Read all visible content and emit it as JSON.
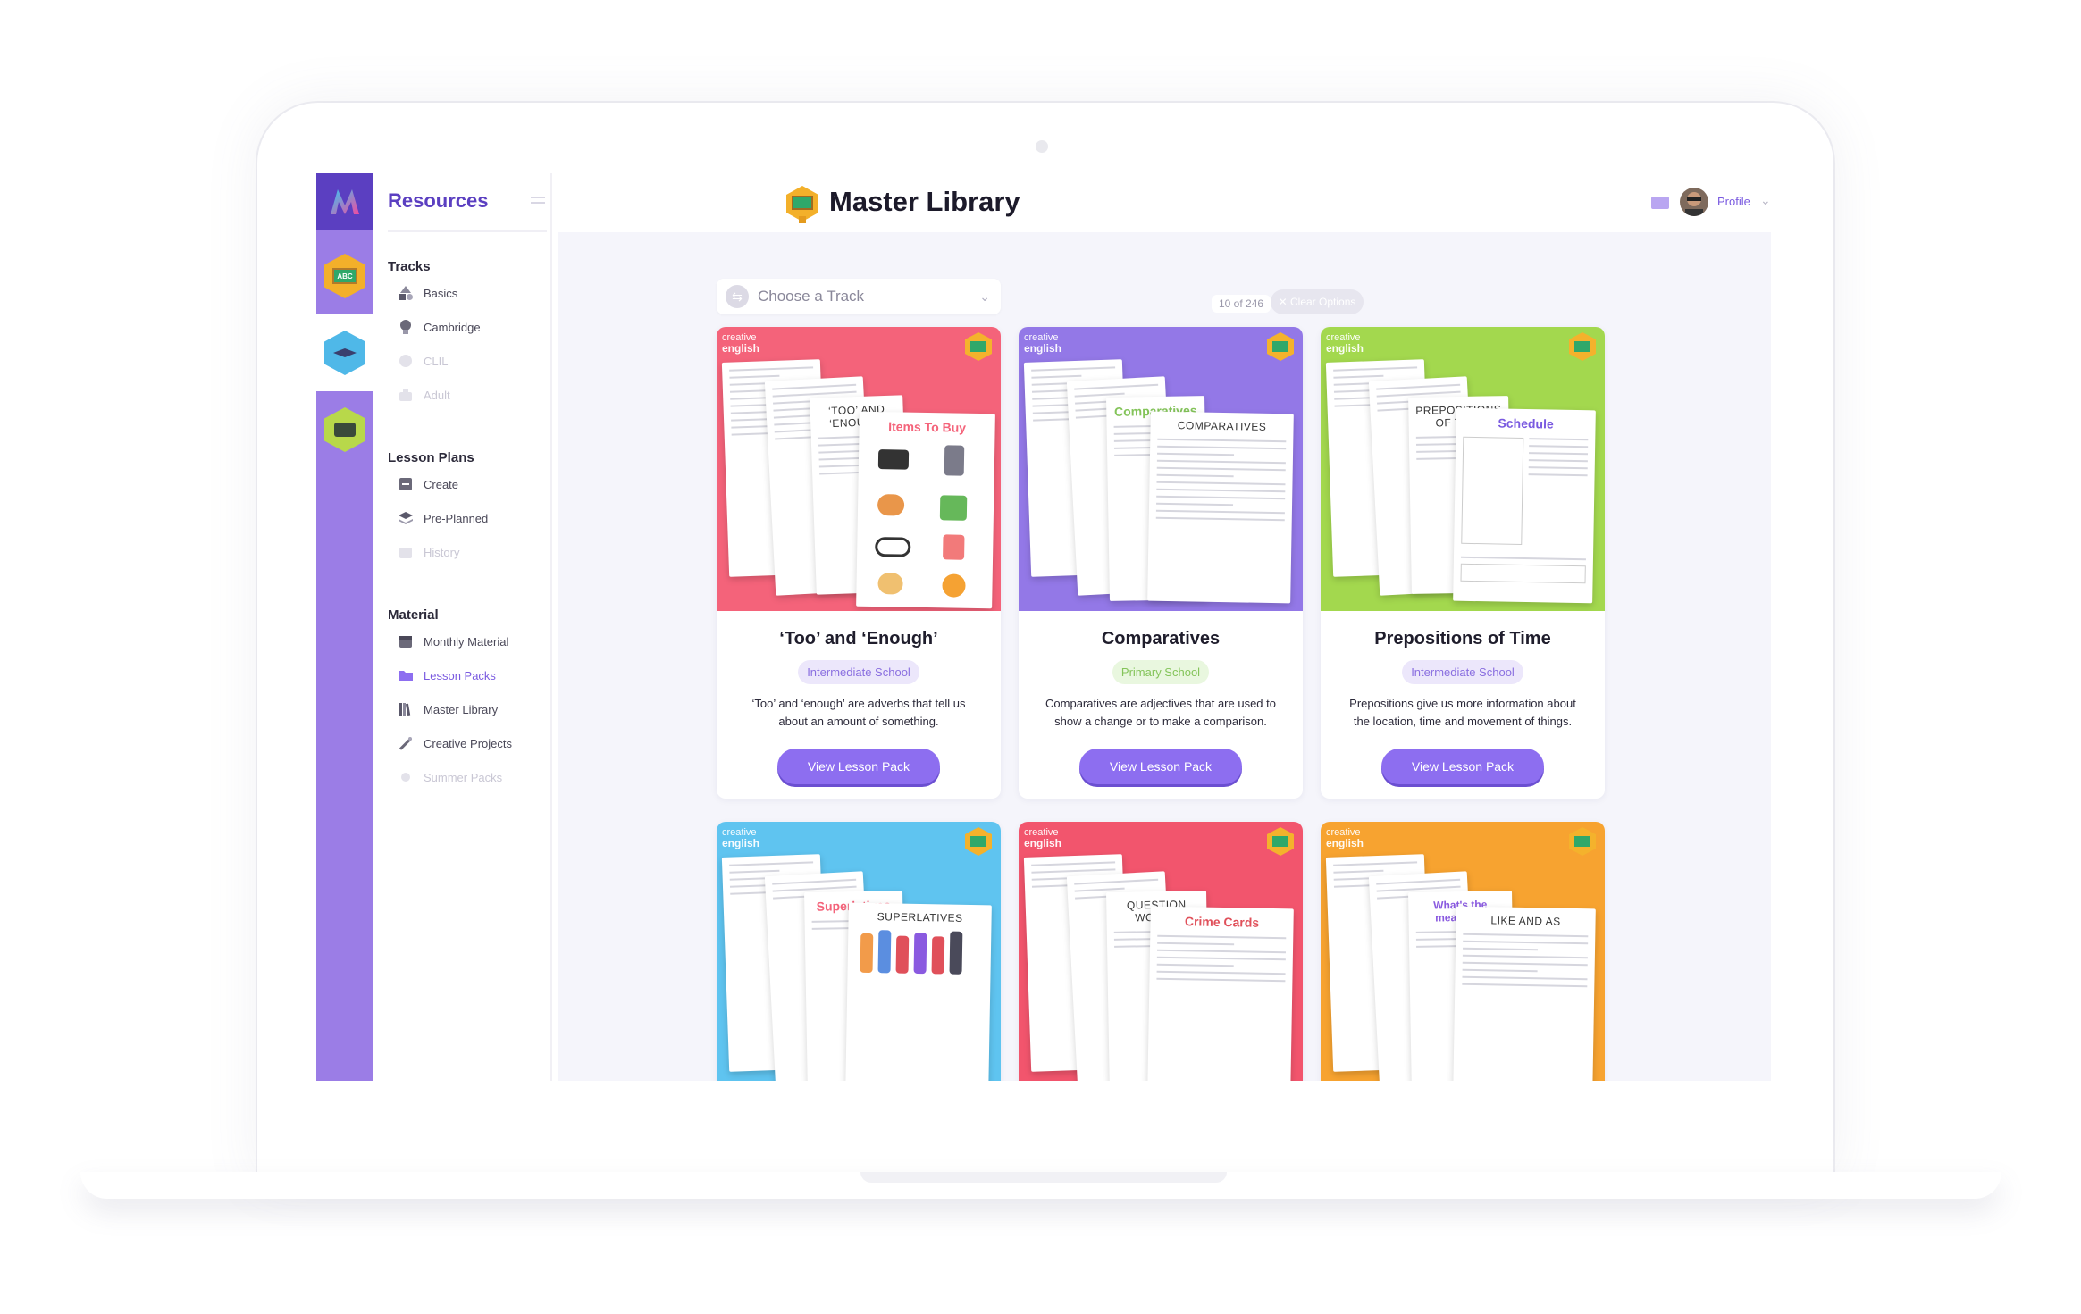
{
  "sidebar": {
    "title": "Resources",
    "sections": [
      {
        "label": "Tracks",
        "items": [
          {
            "label": "Basics",
            "state": "normal",
            "icon": "shapes-icon"
          },
          {
            "label": "Cambridge",
            "state": "normal",
            "icon": "cambridge-icon"
          },
          {
            "label": "CLIL",
            "state": "disabled",
            "icon": "globe-icon"
          },
          {
            "label": "Adult",
            "state": "disabled",
            "icon": "briefcase-icon"
          }
        ]
      },
      {
        "label": "Lesson Plans",
        "items": [
          {
            "label": "Create",
            "state": "normal",
            "icon": "create-icon"
          },
          {
            "label": "Pre-Planned",
            "state": "normal",
            "icon": "layers-icon"
          },
          {
            "label": "History",
            "state": "disabled",
            "icon": "history-icon"
          }
        ]
      },
      {
        "label": "Material",
        "items": [
          {
            "label": "Monthly Material",
            "state": "normal",
            "icon": "calendar-icon"
          },
          {
            "label": "Lesson Packs",
            "state": "active",
            "icon": "folder-icon"
          },
          {
            "label": "Master Library",
            "state": "normal",
            "icon": "books-icon"
          },
          {
            "label": "Creative Projects",
            "state": "normal",
            "icon": "wand-icon"
          },
          {
            "label": "Summer Packs",
            "state": "disabled",
            "icon": "sun-icon"
          }
        ]
      }
    ]
  },
  "header": {
    "title": "Master Library",
    "profile_label": "Profile"
  },
  "filters": {
    "track_placeholder": "Choose a Track",
    "count": "10 of 246",
    "clear_label": "Clear Options"
  },
  "brand": {
    "creative": "creative",
    "english": "english"
  },
  "cards": [
    {
      "title": "‘Too’ and ‘Enough’",
      "level": "Intermediate School",
      "description": "‘Too’ and ‘enough’ are adverbs that tell us about an amount of something.",
      "button": "View Lesson Pack",
      "sheet_heading": "Items To Buy",
      "sheet_subheading": "‘TOO’ AND ‘ENOUGH’",
      "color": "#f4637a"
    },
    {
      "title": "Comparatives",
      "level": "Primary School",
      "description": "Comparatives are adjectives that are used to show a change or to make a comparison.",
      "button": "View Lesson Pack",
      "sheet_heading": "Comparatives",
      "sheet_subheading": "COMPARATIVES",
      "color": "#9378e7"
    },
    {
      "title": "Prepositions of Time",
      "level": "Intermediate School",
      "description": "Prepositions give us more information about the location, time and movement of things.",
      "button": "View Lesson Pack",
      "sheet_heading": "Schedule",
      "sheet_subheading": "PREPOSITIONS OF TIME",
      "color": "#a3d84e"
    },
    {
      "title": "",
      "level": "",
      "description": "",
      "button": "",
      "sheet_heading": "Superlatives",
      "sheet_subheading": "SUPERLATIVES",
      "color": "#5fc4f0"
    },
    {
      "title": "",
      "level": "",
      "description": "",
      "button": "",
      "sheet_heading": "Crime Cards",
      "sheet_subheading": "QUESTION WORDS",
      "color": "#f2556d"
    },
    {
      "title": "",
      "level": "",
      "description": "",
      "button": "",
      "sheet_heading": "What's the meaning?",
      "sheet_subheading": "LIKE AND AS",
      "color": "#f7a330"
    }
  ],
  "colors": {
    "accent": "#7a5ae0",
    "rail": "#9b7de6",
    "button": "#8d6ef0"
  }
}
